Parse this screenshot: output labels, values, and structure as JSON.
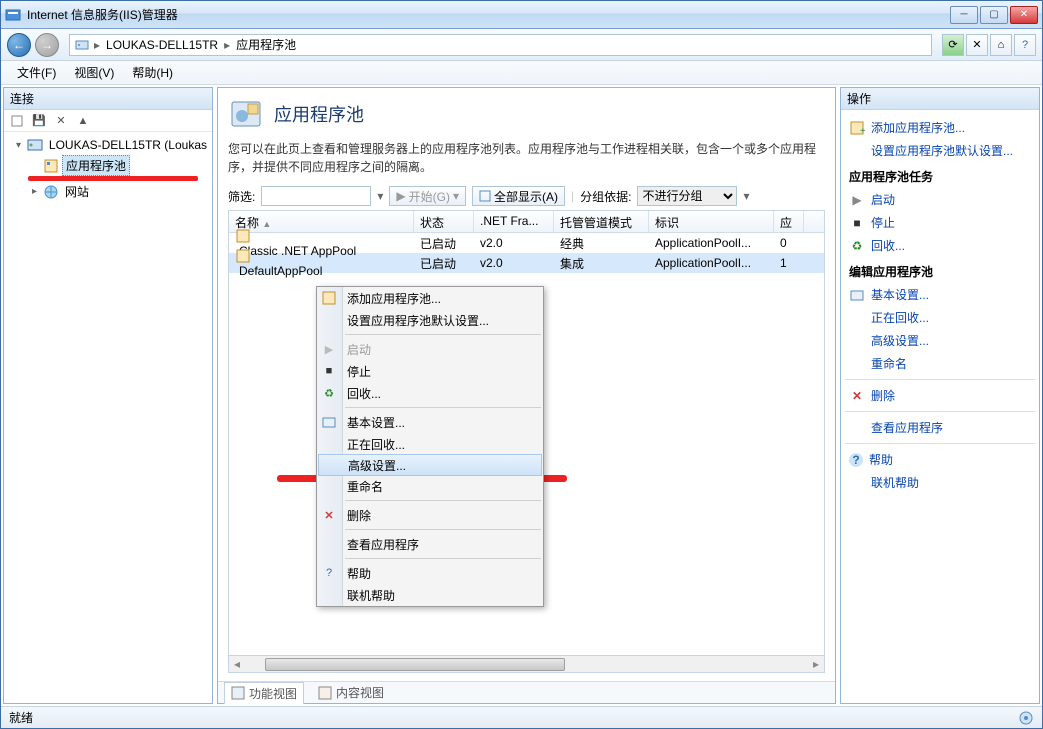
{
  "window": {
    "title": "Internet 信息服务(IIS)管理器"
  },
  "nav": {
    "breadcrumb": [
      "LOUKAS-DELL15TR",
      "应用程序池"
    ]
  },
  "menubar": {
    "file": "文件(F)",
    "view": "视图(V)",
    "help": "帮助(H)"
  },
  "left_panel": {
    "title": "连接",
    "root": "LOUKAS-DELL15TR (Loukas",
    "app_pools": "应用程序池",
    "sites": "网站"
  },
  "center": {
    "title": "应用程序池",
    "description": "您可以在此页上查看和管理服务器上的应用程序池列表。应用程序池与工作进程相关联，包含一个或多个应用程序，并提供不同应用程序之间的隔离。",
    "filter_label": "筛选:",
    "go_label": "开始(G)",
    "showall_label": "全部显示(A)",
    "groupby_label": "分组依据:",
    "groupby_value": "不进行分组",
    "columns": {
      "name": "名称",
      "status": "状态",
      "netfw": ".NET Fra...",
      "mode": "托管管道模式",
      "identity": "标识",
      "apps": "应"
    },
    "rows": [
      {
        "name": "Classic .NET AppPool",
        "status": "已启动",
        "net": "v2.0",
        "mode": "经典",
        "identity": "ApplicationPoolI...",
        "apps": "0"
      },
      {
        "name": "DefaultAppPool",
        "status": "已启动",
        "net": "v2.0",
        "mode": "集成",
        "identity": "ApplicationPoolI...",
        "apps": "1"
      }
    ]
  },
  "context_menu": {
    "add": "添加应用程序池...",
    "defaults": "设置应用程序池默认设置...",
    "start": "启动",
    "stop": "停止",
    "recycle": "回收...",
    "basic": "基本设置...",
    "recycling": "正在回收...",
    "advanced": "高级设置...",
    "rename": "重命名",
    "delete": "删除",
    "viewapps": "查看应用程序",
    "help": "帮助",
    "onlinehelp": "联机帮助"
  },
  "right_panel": {
    "title": "操作",
    "add": "添加应用程序池...",
    "defaults": "设置应用程序池默认设置...",
    "tasks_header": "应用程序池任务",
    "start": "启动",
    "stop": "停止",
    "recycle": "回收...",
    "edit_header": "编辑应用程序池",
    "basic": "基本设置...",
    "recycling": "正在回收...",
    "advanced": "高级设置...",
    "rename": "重命名",
    "delete": "删除",
    "viewapps": "查看应用程序",
    "help": "帮助",
    "onlinehelp": "联机帮助"
  },
  "footer_tabs": {
    "features": "功能视图",
    "content": "内容视图"
  },
  "status": {
    "ready": "就绪"
  }
}
